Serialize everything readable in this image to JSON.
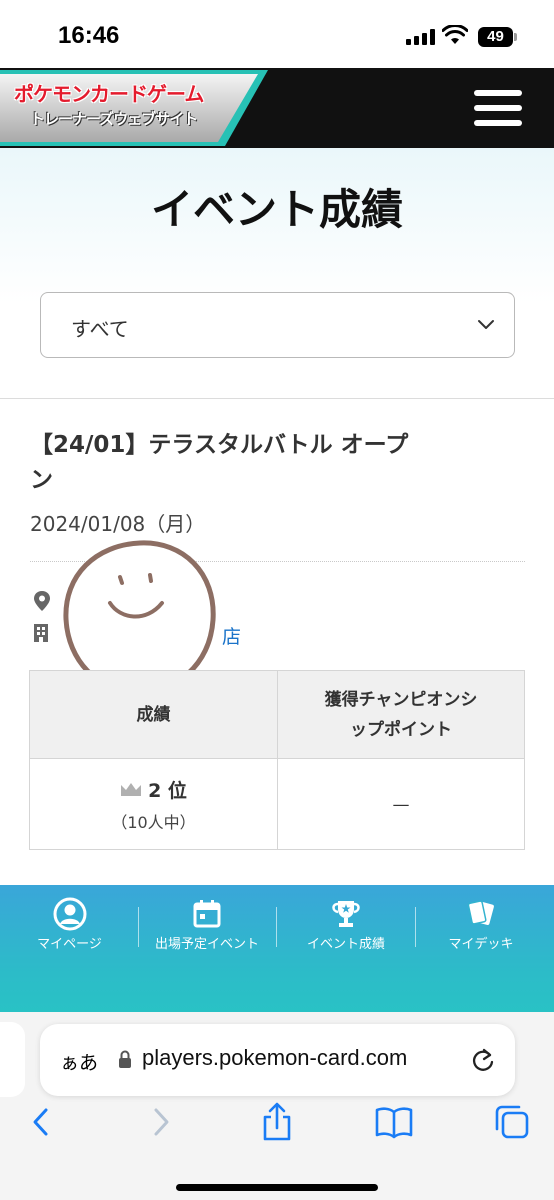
{
  "status_bar": {
    "time": "16:46",
    "battery": "49"
  },
  "header": {
    "logo_line1": "ポケモンカードゲーム",
    "logo_line2": "トレーナーズウェブサイト",
    "menu_icon": "hamburger-icon"
  },
  "page": {
    "title": "イベント成績"
  },
  "filter": {
    "selected": "すべて",
    "icon": "chevron-down-icon"
  },
  "event": {
    "title": "【24/01】テラスタルバトル オープン",
    "date": "2024/01/08（月）",
    "venue_icon": "map-pin-icon",
    "shop_icon": "building-icon",
    "shop_suffix": "店"
  },
  "results_table": {
    "headers": [
      "成績",
      "獲得チャンピオンシップポイント"
    ],
    "rank": "2 位",
    "participants": "（10人中）",
    "points": "—",
    "rank_icon": "crown-icon"
  },
  "bottom_nav": {
    "items": [
      {
        "label": "マイページ",
        "icon": "user-circle-icon"
      },
      {
        "label": "出場予定イベント",
        "icon": "calendar-icon"
      },
      {
        "label": "イベント成績",
        "icon": "trophy-icon"
      },
      {
        "label": "マイデッキ",
        "icon": "cards-icon"
      }
    ]
  },
  "browser": {
    "text_size": "ぁあ",
    "url": "players.pokemon-card.com",
    "colors": {
      "accent": "#1a7cf5"
    }
  }
}
